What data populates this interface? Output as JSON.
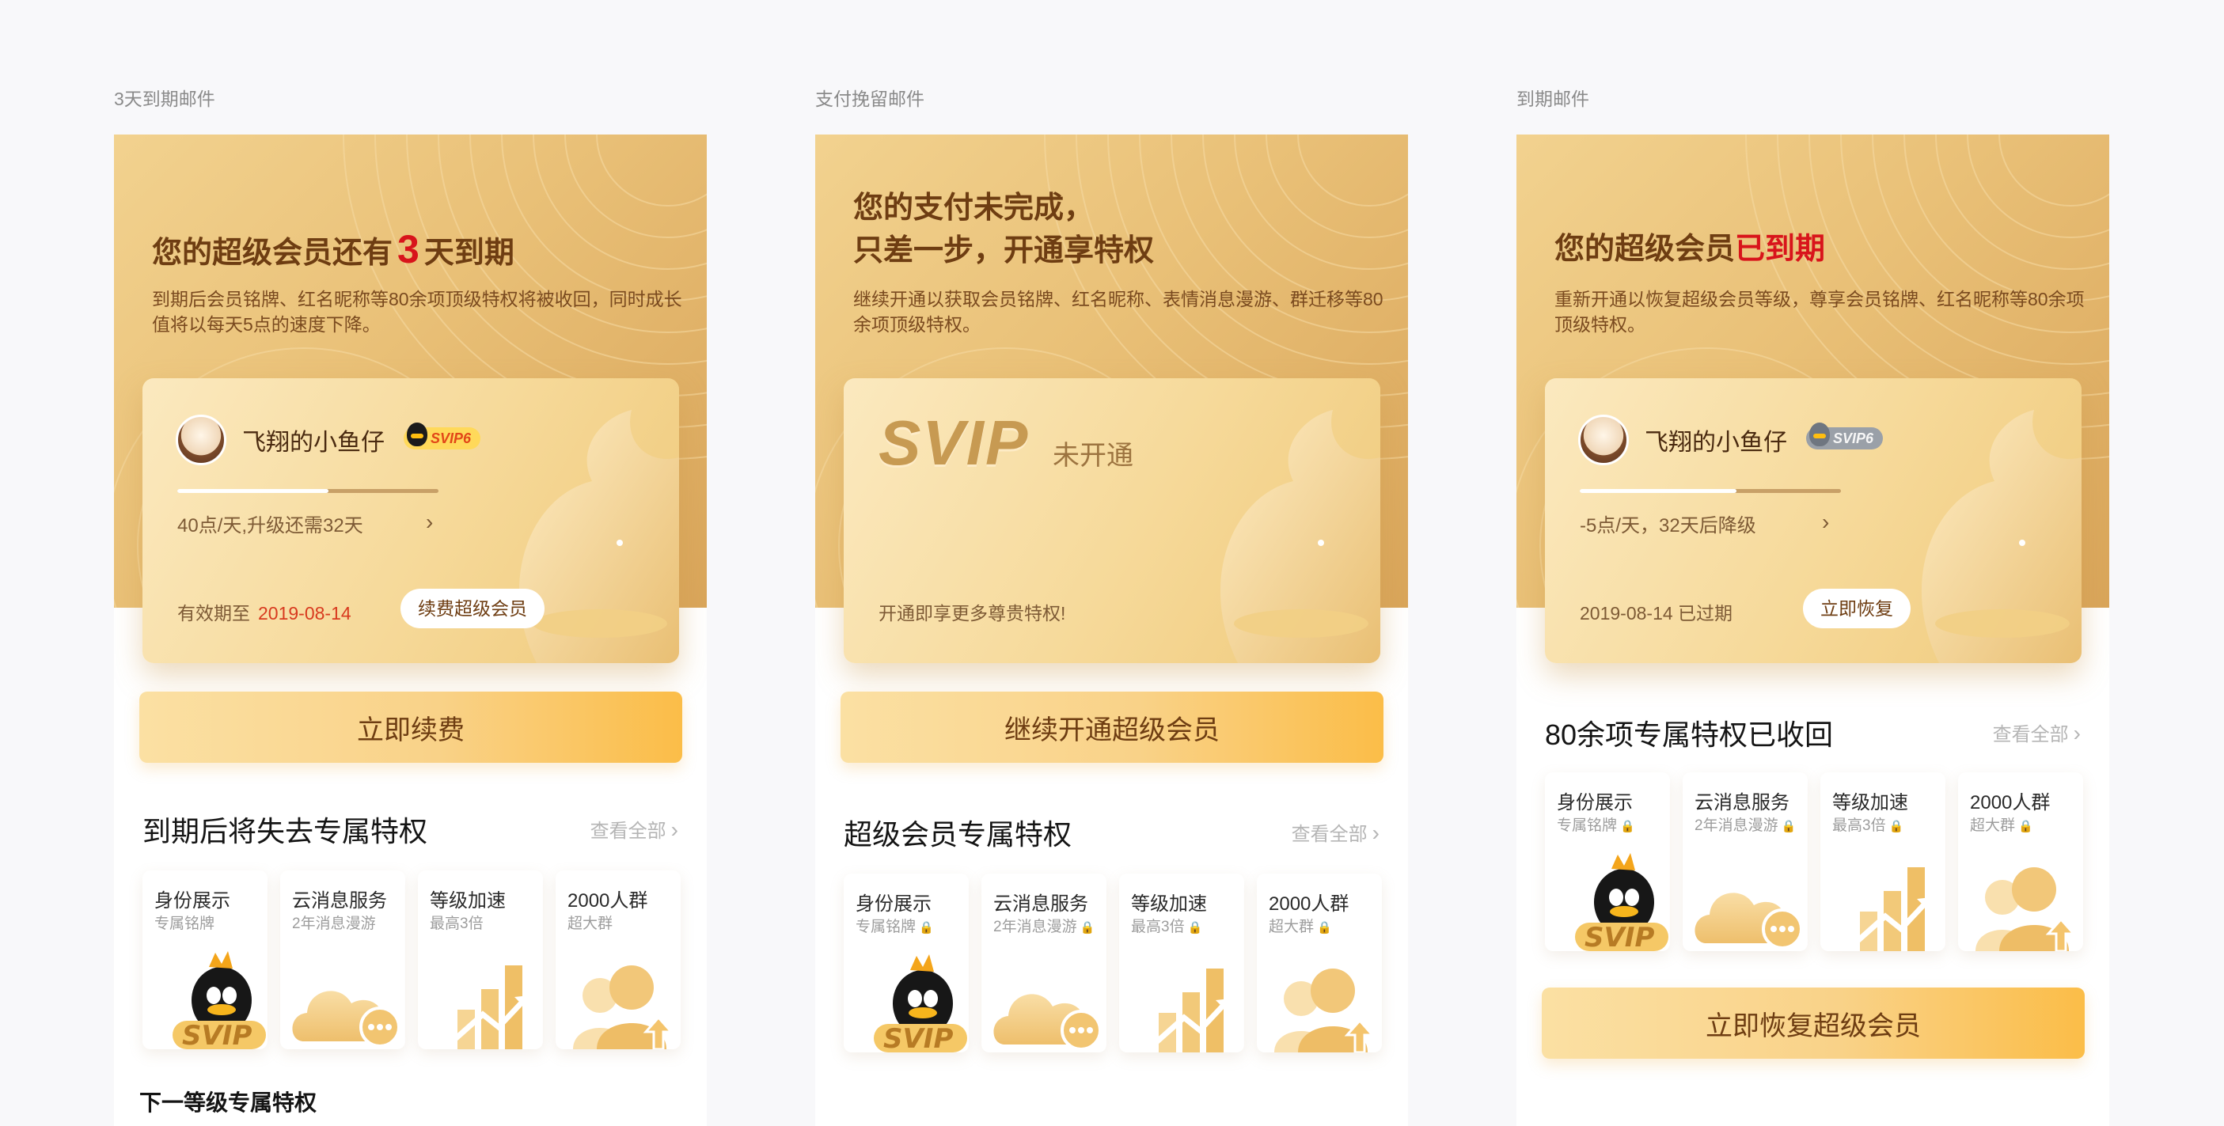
{
  "colors": {
    "accent_red": "#d8141b",
    "gold": "#e9c077",
    "button_gradient_end": "#fbbd48"
  },
  "panels": [
    {
      "label": "3天到期邮件",
      "hero": {
        "title_before": "您的超级会员还有",
        "title_num": "3",
        "title_after": "天到期",
        "desc": "到期后会员铭牌、红名昵称等80余项顶级特权将被收回，同时成长值将以每天5点的速度下降。"
      },
      "card": {
        "nickname": "飞翔的小鱼仔",
        "badge": "SVIP6",
        "progress": 0.58,
        "points": "40点/天,升级还需32天",
        "chevron": "›",
        "expire_label": "有效期至",
        "expire_date": "2019-08-14",
        "button": "续费超级会员"
      },
      "main_button": "立即续费",
      "section_title": "到期后将失去专属特权",
      "see_all": "查看全部",
      "see_all_arrow": "›",
      "privileges": [
        {
          "title": "身份展示",
          "sub": "专属铭牌",
          "icon": "penguin-svip-icon"
        },
        {
          "title": "云消息服务",
          "sub": "2年消息漫游",
          "icon": "cloud-chat-icon"
        },
        {
          "title": "等级加速",
          "sub": "最高3倍",
          "icon": "bar-chart-up-icon"
        },
        {
          "title": "2000人群",
          "sub": "超大群",
          "icon": "group-up-icon"
        }
      ],
      "next_level": "下一等级专属特权"
    },
    {
      "label": "支付挽留邮件",
      "hero": {
        "title_line1": "您的支付未完成，",
        "title_line2": "只差一步，开通享特权",
        "desc": "继续开通以获取会员铭牌、红名昵称、表情消息漫游、群迁移等80余项顶级特权。"
      },
      "card": {
        "logo": "SVIP",
        "status": "未开通",
        "hint": "开通即享更多尊贵特权!"
      },
      "main_button": "继续开通超级会员",
      "section_title": "超级会员专属特权",
      "see_all": "查看全部",
      "see_all_arrow": "›",
      "lock_glyph": "🔒",
      "privileges": [
        {
          "title": "身份展示",
          "sub": "专属铭牌",
          "icon": "penguin-svip-icon"
        },
        {
          "title": "云消息服务",
          "sub": "2年消息漫游",
          "icon": "cloud-chat-icon"
        },
        {
          "title": "等级加速",
          "sub": "最高3倍",
          "icon": "bar-chart-up-icon"
        },
        {
          "title": "2000人群",
          "sub": "超大群",
          "icon": "group-up-icon"
        }
      ]
    },
    {
      "label": "到期邮件",
      "hero": {
        "title_before": "您的超级会员",
        "title_em": "已到期",
        "desc": "重新开通以恢复超级会员等级，尊享会员铭牌、红名昵称等80余项顶级特权。"
      },
      "card": {
        "nickname": "飞翔的小鱼仔",
        "badge": "SVIP6",
        "progress": 0.6,
        "points": "-5点/天，32天后降级",
        "chevron": "›",
        "expire_date": "2019-08-14",
        "expire_status": "已过期",
        "button": "立即恢复"
      },
      "section_title": "80余项专属特权已收回",
      "see_all": "查看全部",
      "see_all_arrow": "›",
      "lock_glyph": "🔒",
      "privileges": [
        {
          "title": "身份展示",
          "sub": "专属铭牌",
          "icon": "penguin-svip-icon"
        },
        {
          "title": "云消息服务",
          "sub": "2年消息漫游",
          "icon": "cloud-chat-icon"
        },
        {
          "title": "等级加速",
          "sub": "最高3倍",
          "icon": "bar-chart-up-icon"
        },
        {
          "title": "2000人群",
          "sub": "超大群",
          "icon": "group-up-icon"
        }
      ],
      "main_button": "立即恢复超级会员"
    }
  ]
}
